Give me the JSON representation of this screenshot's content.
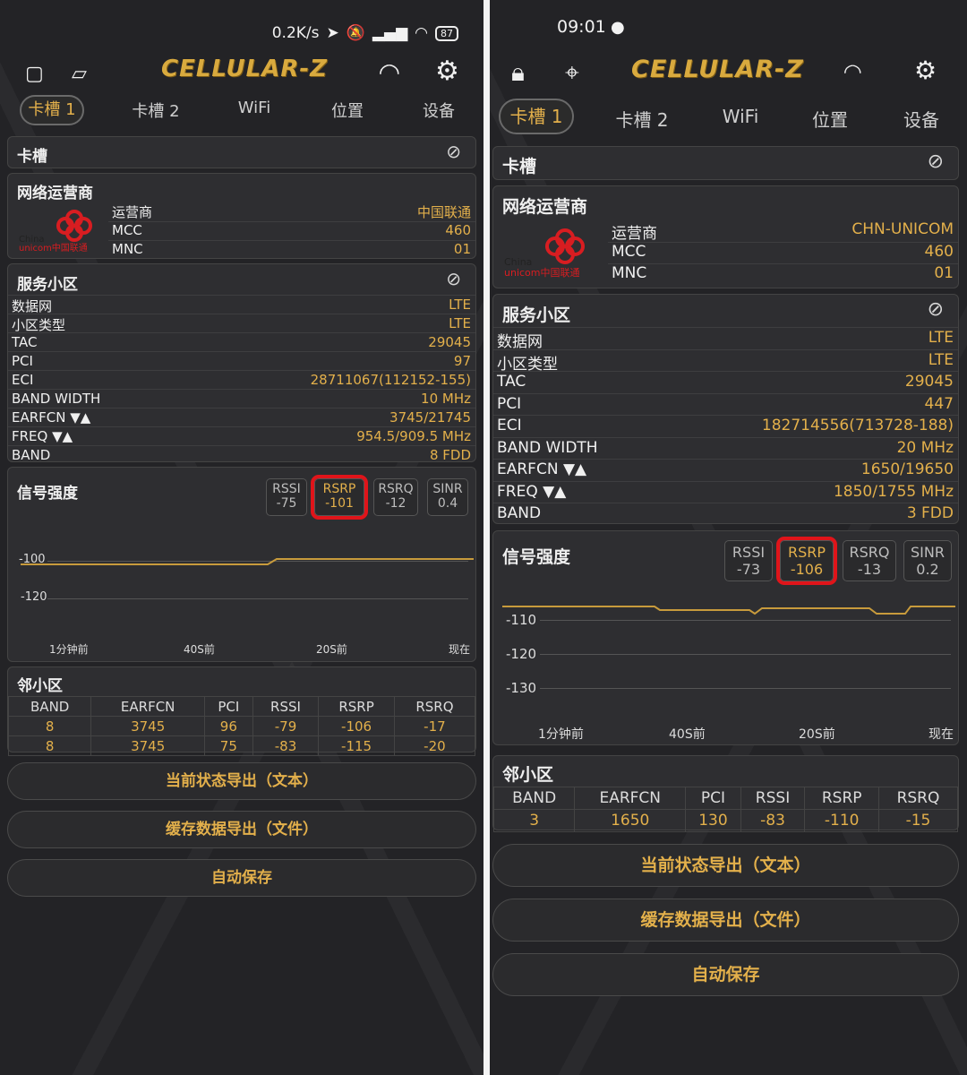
{
  "left": {
    "status": {
      "net_speed": "0.2K/s",
      "battery": "87"
    },
    "app_title": "CELLULAR-Z",
    "tabs": [
      "卡槽 1",
      "卡槽 2",
      "WiFi",
      "位置",
      "设备"
    ],
    "sim_card_title": "卡槽",
    "operator": {
      "title": "网络运营商",
      "logo_text": "China unicom中国联通",
      "rows": [
        {
          "k": "运营商",
          "v": "中国联通"
        },
        {
          "k": "MCC",
          "v": "460"
        },
        {
          "k": "MNC",
          "v": "01"
        }
      ]
    },
    "serving": {
      "title": "服务小区",
      "rows": [
        {
          "k": "数据网",
          "v": "LTE"
        },
        {
          "k": "小区类型",
          "v": "LTE"
        },
        {
          "k": "TAC",
          "v": "29045"
        },
        {
          "k": "PCI",
          "v": "97"
        },
        {
          "k": "ECI",
          "v": "28711067(112152-155)"
        },
        {
          "k": "BAND WIDTH",
          "v": "10 MHz"
        },
        {
          "k": "EARFCN ▼▲",
          "v": "3745/21745"
        },
        {
          "k": "FREQ ▼▲",
          "v": "954.5/909.5 MHz"
        },
        {
          "k": "BAND",
          "v": "8 FDD"
        }
      ]
    },
    "signal": {
      "title": "信号强度",
      "boxes": [
        {
          "label": "RSSI",
          "value": "-75"
        },
        {
          "label": "RSRP",
          "value": "-101"
        },
        {
          "label": "RSRQ",
          "value": "-12"
        },
        {
          "label": "SINR",
          "value": "0.4"
        }
      ],
      "yticks": [
        "-100",
        "-120"
      ],
      "xticks": [
        "1分钟前",
        "40S前",
        "20S前",
        "现在"
      ]
    },
    "neighbors": {
      "title": "邻小区",
      "columns": [
        "BAND",
        "EARFCN",
        "PCI",
        "RSSI",
        "RSRP",
        "RSRQ"
      ],
      "rows": [
        [
          "8",
          "3745",
          "96",
          "-79",
          "-106",
          "-17"
        ],
        [
          "8",
          "3745",
          "75",
          "-83",
          "-115",
          "-20"
        ]
      ]
    },
    "buttons": [
      "当前状态导出（文本）",
      "缓存数据导出（文件）",
      "自动保存"
    ]
  },
  "right": {
    "status": {
      "time": "09:01"
    },
    "app_title": "CELLULAR-Z",
    "tabs": [
      "卡槽 1",
      "卡槽 2",
      "WiFi",
      "位置",
      "设备"
    ],
    "sim_card_title": "卡槽",
    "operator": {
      "title": "网络运营商",
      "logo_text": "China unicom中国联通",
      "rows": [
        {
          "k": "运营商",
          "v": "CHN-UNICOM"
        },
        {
          "k": "MCC",
          "v": "460"
        },
        {
          "k": "MNC",
          "v": "01"
        }
      ]
    },
    "serving": {
      "title": "服务小区",
      "rows": [
        {
          "k": "数据网",
          "v": "LTE"
        },
        {
          "k": "小区类型",
          "v": "LTE"
        },
        {
          "k": "TAC",
          "v": "29045"
        },
        {
          "k": "PCI",
          "v": "447"
        },
        {
          "k": "ECI",
          "v": "182714556(713728-188)"
        },
        {
          "k": "BAND WIDTH",
          "v": "20 MHz"
        },
        {
          "k": "EARFCN ▼▲",
          "v": "1650/19650"
        },
        {
          "k": "FREQ ▼▲",
          "v": "1850/1755 MHz"
        },
        {
          "k": "BAND",
          "v": "3 FDD"
        }
      ]
    },
    "signal": {
      "title": "信号强度",
      "boxes": [
        {
          "label": "RSSI",
          "value": "-73"
        },
        {
          "label": "RSRP",
          "value": "-106"
        },
        {
          "label": "RSRQ",
          "value": "-13"
        },
        {
          "label": "SINR",
          "value": "0.2"
        }
      ],
      "yticks": [
        "-110",
        "-120",
        "-130"
      ],
      "xticks": [
        "1分钟前",
        "40S前",
        "20S前",
        "现在"
      ]
    },
    "neighbors": {
      "title": "邻小区",
      "columns": [
        "BAND",
        "EARFCN",
        "PCI",
        "RSSI",
        "RSRP",
        "RSRQ"
      ],
      "rows": [
        [
          "3",
          "1650",
          "130",
          "-83",
          "-110",
          "-15"
        ]
      ]
    },
    "buttons": [
      "当前状态导出（文本）",
      "缓存数据导出（文件）",
      "自动保存"
    ]
  },
  "colors": {
    "accent": "#e3b04b",
    "highlight": "#e0141a",
    "background": "#232326"
  }
}
